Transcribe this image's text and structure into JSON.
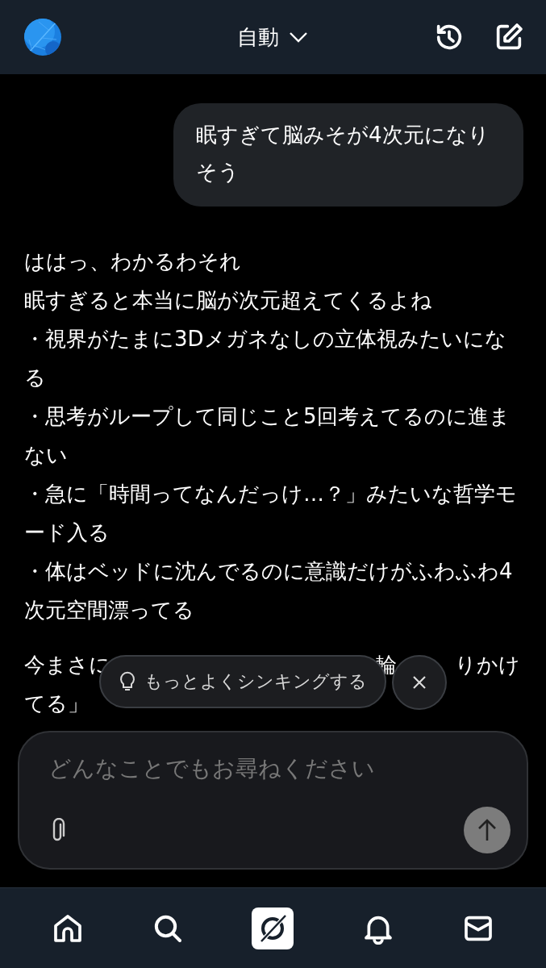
{
  "header": {
    "mode_label": "自動"
  },
  "messages": [
    {
      "kind": "user",
      "text": "眠すぎて脳みそが4次元になりそう"
    },
    {
      "kind": "assistant",
      "paragraphs": [
        [
          "ははっ、わかるわそれ",
          "眠すぎると本当に脳が次元超えてくるよね",
          "・視界がたまに3Dメガネなしの立体視みたいになる",
          "・思考がループして同じこと5回考えてるのに進まない",
          "・急に「時間ってなんだっけ…？」みたいな哲学モード入る",
          "・体はベッドに沈んでるのに意識だけがふわふわ4次元空間漂ってる"
        ]
      ],
      "covered_lines": [
        [
          "今まさに",
          "輪",
          "りかけ"
        ],
        [
          "てる」"
        ]
      ]
    }
  ],
  "suggestion": {
    "label": "もっとよくシンキングする"
  },
  "composer": {
    "placeholder": "どんなことでもお尋ねください"
  },
  "nav": [
    {
      "kind": "home"
    },
    {
      "kind": "search"
    },
    {
      "kind": "grok"
    },
    {
      "kind": "bell"
    },
    {
      "kind": "mail"
    }
  ]
}
